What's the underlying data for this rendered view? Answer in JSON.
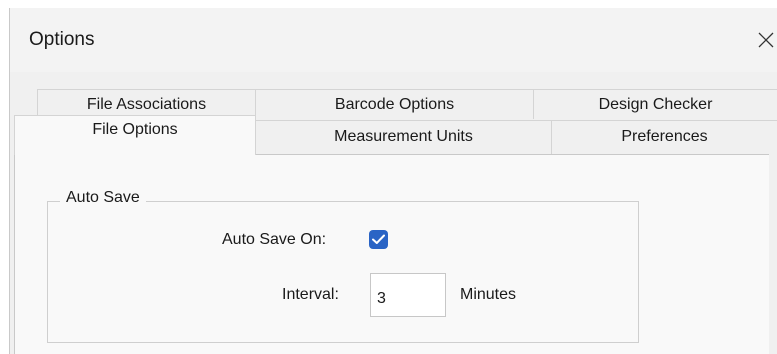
{
  "dialog": {
    "title": "Options",
    "close_icon": "close-icon"
  },
  "tabs": {
    "back_row": [
      "File Associations",
      "Barcode Options",
      "Design Checker"
    ],
    "front_row": [
      "File Options",
      "Measurement Units",
      "Preferences"
    ],
    "selected": "File Options"
  },
  "auto_save": {
    "group_label": "Auto Save",
    "auto_save_on_label": "Auto Save On:",
    "auto_save_on_checked": true,
    "interval_label": "Interval:",
    "interval_value": "3",
    "interval_unit": "Minutes"
  },
  "colors": {
    "accent": "#2a64c5"
  }
}
